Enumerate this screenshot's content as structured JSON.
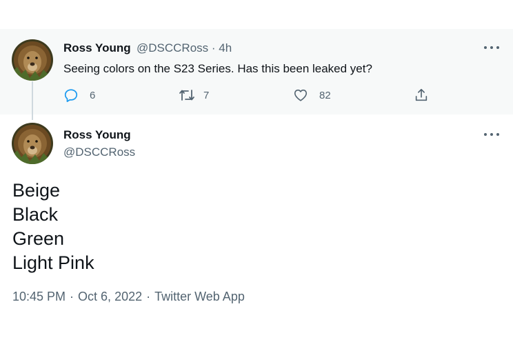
{
  "reply_to": {
    "name": "Ross Young",
    "handle": "@DSCCRoss",
    "time": "4h",
    "text": "Seeing colors on the S23 Series. Has this been leaked yet?",
    "actions": {
      "replies": "6",
      "retweets": "7",
      "likes": "82"
    }
  },
  "tweet": {
    "name": "Ross Young",
    "handle": "@DSCCRoss",
    "lines": [
      "Beige",
      "Black",
      "Green",
      "Light Pink"
    ],
    "time": "10:45 PM",
    "date": "Oct 6, 2022",
    "source": "Twitter Web App"
  },
  "icons": [
    "more-icon",
    "reply-icon",
    "retweet-icon",
    "like-icon",
    "share-icon"
  ],
  "colors": {
    "text": "#0f1419",
    "secondary": "#536471",
    "highlight_bg": "#f7f9f9",
    "reply_icon": "#1d9bf0"
  }
}
